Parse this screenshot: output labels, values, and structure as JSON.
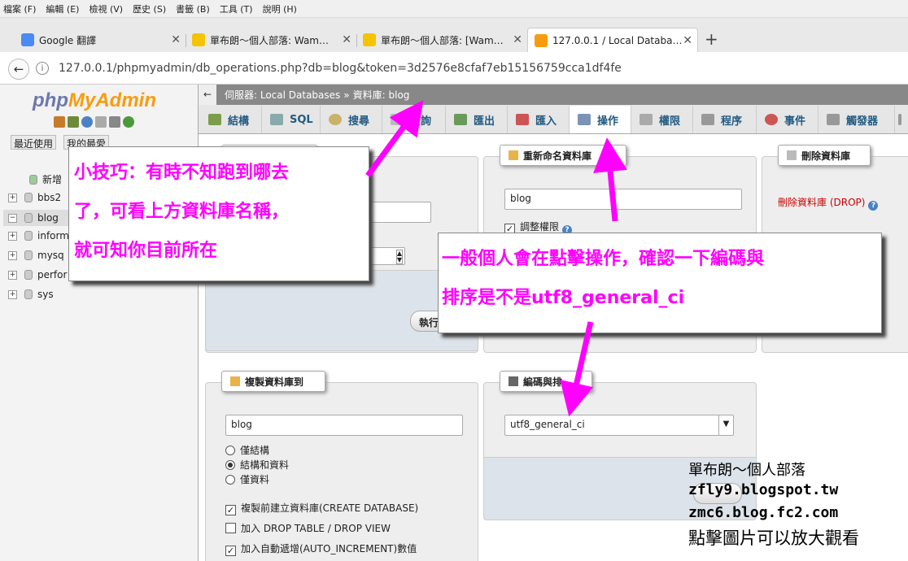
{
  "browser": {
    "menu": [
      "檔案 (F)",
      "編輯 (E)",
      "檢視 (V)",
      "歷史 (S)",
      "書籤 (B)",
      "工具 (T)",
      "說明 (H)"
    ],
    "tabs": [
      {
        "title": "Google 翻譯"
      },
      {
        "title": "單布朗～個人部落: Wam…"
      },
      {
        "title": "單布朗～個人部落: [Wam…"
      },
      {
        "title": "127.0.0.1 / Local Databa…"
      }
    ],
    "new_tab": "+",
    "url": "127.0.0.1/phpmyadmin/db_operations.php?db=blog&token=3d2576e8cfaf7eb15156759cca1df4fe"
  },
  "sidebar": {
    "logo_php": "php",
    "logo_myadmin": "MyAdmin",
    "btn_recent": "最近使用",
    "btn_fav": "我的最愛",
    "tree": [
      {
        "label": "新增",
        "toggle": ""
      },
      {
        "label": "bbs2",
        "toggle": "+"
      },
      {
        "label": "blog",
        "toggle": "−"
      },
      {
        "label": "inform",
        "toggle": "+"
      },
      {
        "label": "mysq",
        "toggle": "+"
      },
      {
        "label": "perfor",
        "toggle": "+"
      },
      {
        "label": "sys",
        "toggle": "+"
      }
    ]
  },
  "breadcrumb": {
    "back": "←",
    "server": "伺服器: Local Databases",
    "sep": "»",
    "database": "資料庫: blog"
  },
  "pma_tabs": [
    "結構",
    "SQL",
    "搜尋",
    "查詢",
    "匯出",
    "匯入",
    "操作",
    "權限",
    "程序",
    "事件",
    "觸發器"
  ],
  "panels": {
    "rename": {
      "legend": "重新命名資料庫",
      "value": "blog",
      "adjust_priv": "調整權限"
    },
    "drop": {
      "legend": "刪除資料庫",
      "link": "刪除資料庫 (DROP)"
    },
    "copy": {
      "legend": "複製資料庫到",
      "value": "blog",
      "radio": [
        "僅結構",
        "結構和資料",
        "僅資料"
      ],
      "checks": [
        "複製前建立資料庫(CREATE DATABASE)",
        "加入 DROP TABLE / DROP VIEW",
        "加入自動遞增(AUTO_INCREMENT)數值"
      ]
    },
    "collation": {
      "legend": "編碼與排",
      "value": "utf8_general_ci"
    },
    "create_table": {
      "go": "執行"
    }
  },
  "callouts": {
    "tip": [
      "小技巧：有時不知跑到哪去",
      "了，可看上方資料庫名稱，",
      "就可知你目前所在"
    ],
    "note": [
      "一般個人會在點擊操作，確認一下編碼與",
      "排序是不是utf8_general_ci"
    ]
  },
  "watermark": {
    "line1": "單布朗～個人部落",
    "line2": "zfly9.blogspot.tw",
    "line3": "zmc6.blog.fc2.com",
    "line4": "點擊圖片可以放大觀看"
  },
  "colors": {
    "arrow": "#ff00ff",
    "pma_link": "#235a81",
    "drop_link": "#cc0000"
  }
}
